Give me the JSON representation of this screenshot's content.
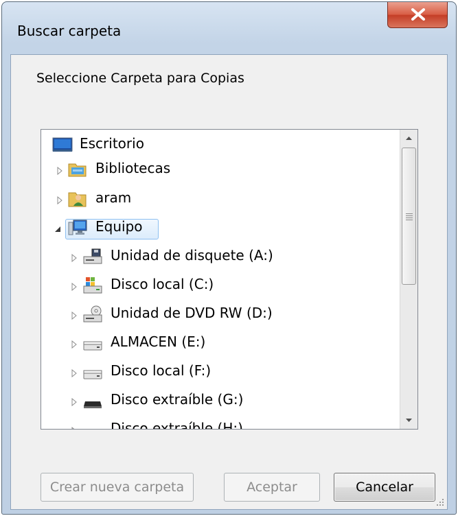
{
  "window": {
    "title": "Buscar carpeta"
  },
  "description": "Seleccione Carpeta para Copias",
  "tree": {
    "items": [
      {
        "label": "Escritorio",
        "icon": "desktop-icon",
        "expander": "none",
        "level": 0
      },
      {
        "label": "Bibliotecas",
        "icon": "libraries-icon",
        "expander": "collapsed",
        "level": 1
      },
      {
        "label": "aram",
        "icon": "user-folder-icon",
        "expander": "collapsed",
        "level": 1
      },
      {
        "label": "Equipo",
        "icon": "computer-icon",
        "expander": "expanded",
        "level": 1,
        "selected": true
      },
      {
        "label": "Unidad de disquete (A:)",
        "icon": "floppy-drive-icon",
        "expander": "collapsed",
        "level": 2
      },
      {
        "label": "Disco local (C:)",
        "icon": "system-drive-icon",
        "expander": "collapsed",
        "level": 2
      },
      {
        "label": "Unidad de DVD RW (D:)",
        "icon": "dvd-drive-icon",
        "expander": "collapsed",
        "level": 2
      },
      {
        "label": "ALMACEN (E:)",
        "icon": "hard-drive-icon",
        "expander": "collapsed",
        "level": 2
      },
      {
        "label": "Disco local (F:)",
        "icon": "hard-drive-icon",
        "expander": "collapsed",
        "level": 2
      },
      {
        "label": "Disco extraíble (G:)",
        "icon": "removable-drive-icon",
        "expander": "collapsed",
        "level": 2
      },
      {
        "label": "Disco extraíble (H:)",
        "icon": "removable-drive-icon",
        "expander": "collapsed",
        "level": 2
      }
    ]
  },
  "buttons": {
    "new_folder": "Crear nueva carpeta",
    "ok": "Aceptar",
    "cancel": "Cancelar"
  },
  "colors": {
    "selection_border": "#8dbff0",
    "close_button": "#c43d26",
    "window_frame": "#bfd0e4"
  }
}
